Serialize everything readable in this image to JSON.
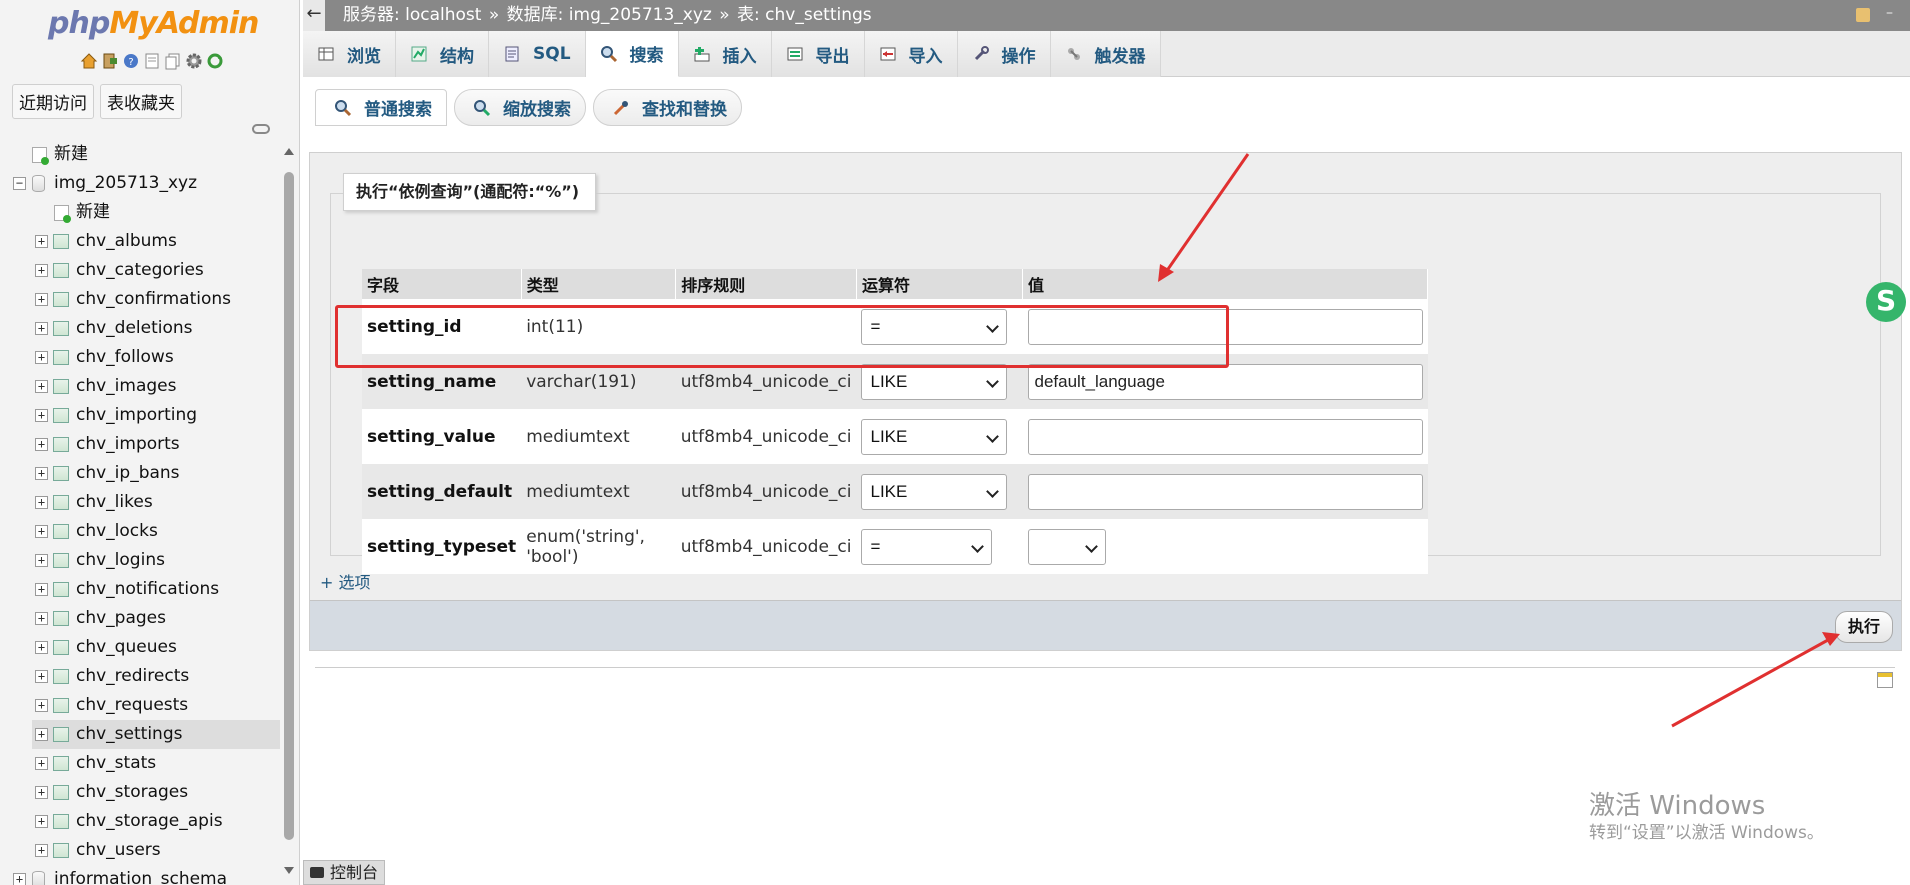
{
  "sidebar": {
    "logo_php": "php",
    "logo_myadmin": "MyAdmin",
    "recent_label": "近期访问",
    "favorites_label": "表收藏夹",
    "tree": [
      {
        "label": "新建",
        "kind": "new",
        "level": 0
      },
      {
        "label": "img_205713_xyz",
        "kind": "db",
        "level": 0
      },
      {
        "label": "新建",
        "kind": "new",
        "level": 1
      },
      {
        "label": "chv_albums",
        "kind": "table",
        "level": 1
      },
      {
        "label": "chv_categories",
        "kind": "table",
        "level": 1
      },
      {
        "label": "chv_confirmations",
        "kind": "table",
        "level": 1
      },
      {
        "label": "chv_deletions",
        "kind": "table",
        "level": 1
      },
      {
        "label": "chv_follows",
        "kind": "table",
        "level": 1
      },
      {
        "label": "chv_images",
        "kind": "table",
        "level": 1
      },
      {
        "label": "chv_importing",
        "kind": "table",
        "level": 1
      },
      {
        "label": "chv_imports",
        "kind": "table",
        "level": 1
      },
      {
        "label": "chv_ip_bans",
        "kind": "table",
        "level": 1
      },
      {
        "label": "chv_likes",
        "kind": "table",
        "level": 1
      },
      {
        "label": "chv_locks",
        "kind": "table",
        "level": 1
      },
      {
        "label": "chv_logins",
        "kind": "table",
        "level": 1
      },
      {
        "label": "chv_notifications",
        "kind": "table",
        "level": 1
      },
      {
        "label": "chv_pages",
        "kind": "table",
        "level": 1
      },
      {
        "label": "chv_queues",
        "kind": "table",
        "level": 1
      },
      {
        "label": "chv_redirects",
        "kind": "table",
        "level": 1
      },
      {
        "label": "chv_requests",
        "kind": "table",
        "level": 1
      },
      {
        "label": "chv_settings",
        "kind": "table",
        "level": 1,
        "selected": true
      },
      {
        "label": "chv_stats",
        "kind": "table",
        "level": 1
      },
      {
        "label": "chv_storages",
        "kind": "table",
        "level": 1
      },
      {
        "label": "chv_storage_apis",
        "kind": "table",
        "level": 1
      },
      {
        "label": "chv_users",
        "kind": "table",
        "level": 1
      },
      {
        "label": "information_schema",
        "kind": "db",
        "level": 0
      }
    ]
  },
  "breadcrumb": {
    "server": "服务器: localhost",
    "sep1": "»",
    "database": "数据库: img_205713_xyz",
    "sep2": "»",
    "table": "表: chv_settings"
  },
  "tabs": [
    {
      "label": "浏览",
      "icon": "browse-icon"
    },
    {
      "label": "结构",
      "icon": "structure-icon"
    },
    {
      "label": "SQL",
      "icon": "sql-icon"
    },
    {
      "label": "搜索",
      "icon": "search-icon",
      "active": true
    },
    {
      "label": "插入",
      "icon": "insert-icon"
    },
    {
      "label": "导出",
      "icon": "export-icon"
    },
    {
      "label": "导入",
      "icon": "import-icon"
    },
    {
      "label": "操作",
      "icon": "wrench-icon"
    },
    {
      "label": "触发器",
      "icon": "trigger-icon"
    }
  ],
  "subtabs": [
    {
      "label": "普通搜索",
      "icon": "search-icon",
      "active": true
    },
    {
      "label": "缩放搜索",
      "icon": "zoom-search-icon"
    },
    {
      "label": "查找和替换",
      "icon": "find-replace-icon"
    }
  ],
  "query": {
    "legend": "执行“依例查询”(通配符:“%”)",
    "headers": [
      "字段",
      "类型",
      "排序规则",
      "运算符",
      "值"
    ],
    "rows": [
      {
        "field": "setting_id",
        "type": "int(11)",
        "collation": "",
        "operator": "=",
        "value": "",
        "value_kind": "input"
      },
      {
        "field": "setting_name",
        "type": "varchar(191)",
        "collation": "utf8mb4_unicode_ci",
        "operator": "LIKE",
        "value": "default_language",
        "value_kind": "input"
      },
      {
        "field": "setting_value",
        "type": "mediumtext",
        "collation": "utf8mb4_unicode_ci",
        "operator": "LIKE",
        "value": "",
        "value_kind": "input"
      },
      {
        "field": "setting_default",
        "type": "mediumtext",
        "collation": "utf8mb4_unicode_ci",
        "operator": "LIKE",
        "value": "",
        "value_kind": "input"
      },
      {
        "field": "setting_typeset",
        "type": "enum('string', 'bool')",
        "collation": "utf8mb4_unicode_ci",
        "operator": "=",
        "value": "",
        "value_kind": "select"
      }
    ],
    "options_link": "+ 选项",
    "go_label": "执行"
  },
  "console_label": "控制台",
  "watermark": {
    "line1": "激活 Windows",
    "line2": "转到“设置”以激活 Windows。"
  },
  "colors": {
    "accent": "#235a81",
    "highlight": "#e03030",
    "logo_php": "#6c78af",
    "logo_myadmin": "#f29111"
  }
}
